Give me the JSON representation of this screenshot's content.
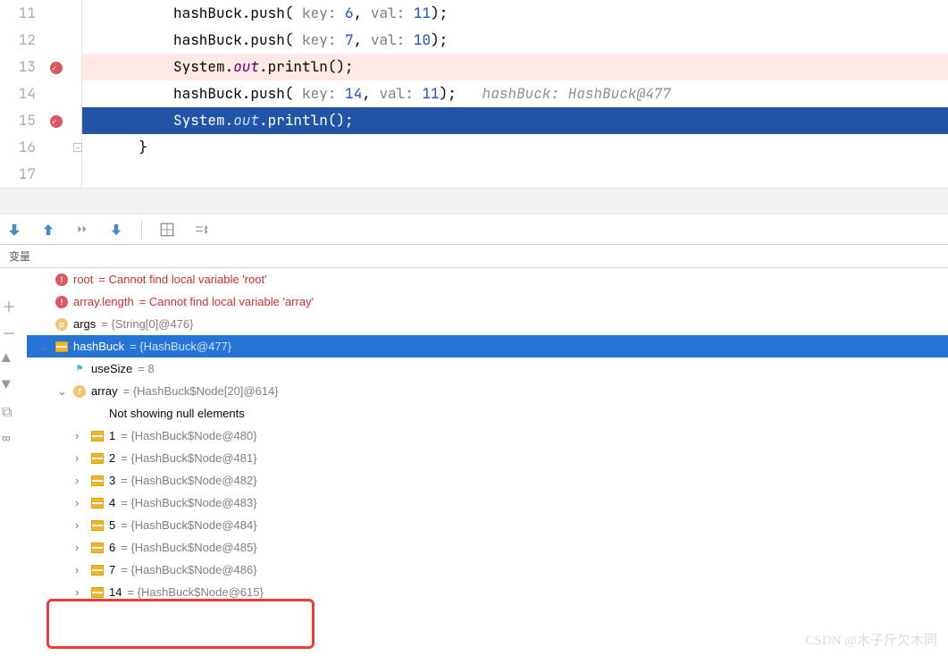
{
  "editor": {
    "lines": [
      {
        "num": "11",
        "bp": false,
        "exec": false,
        "cls": "",
        "html": "hashBuck.push( <gray>key:</gray> <num>6</num>, <gray>val:</gray> <num>11</num>);"
      },
      {
        "num": "12",
        "bp": false,
        "exec": false,
        "cls": "",
        "html": "hashBuck.push( <gray>key:</gray> <num>7</num>, <gray>val:</gray> <num>10</num>);"
      },
      {
        "num": "13",
        "bp": true,
        "exec": false,
        "cls": "row-bp",
        "html": "System.<ital>out</ital>.println();"
      },
      {
        "num": "14",
        "bp": false,
        "exec": false,
        "cls": "",
        "html": "hashBuck.push( <gray>key:</gray> <num>14</num>, <gray>val:</gray> <num>11</num>);   <igray>hashBuck: HashBuck@477</igray>"
      },
      {
        "num": "15",
        "bp": true,
        "exec": true,
        "cls": "row-exec",
        "html": "System.<ital>out</ital>.println();"
      },
      {
        "num": "16",
        "bp": false,
        "exec": false,
        "cls": "",
        "html": "}"
      }
    ],
    "blank": "17"
  },
  "panel": {
    "header": "变量",
    "rows": [
      {
        "d": 0,
        "chev": "",
        "icon": "oct",
        "name": "root",
        "eq": " = ",
        "val": "Cannot find local variable 'root'",
        "err": true
      },
      {
        "d": 0,
        "chev": "",
        "icon": "oct",
        "name": "array.length",
        "eq": " = ",
        "val": "Cannot find local variable 'array'",
        "err": true
      },
      {
        "d": 0,
        "chev": "",
        "icon": "p",
        "name": "args",
        "eq": " = ",
        "val": "{String[0]@476}"
      },
      {
        "d": 0,
        "chev": "v",
        "icon": "node",
        "name": "hashBuck",
        "eq": " = ",
        "val": "{HashBuck@477}",
        "selected": true
      },
      {
        "d": 1,
        "chev": "",
        "icon": "flag",
        "name": "useSize",
        "eq": " = ",
        "val": "8"
      },
      {
        "d": 1,
        "chev": "v",
        "icon": "f",
        "name": "array",
        "eq": " = ",
        "val": "{HashBuck$Node[20]@614}"
      },
      {
        "d": 2,
        "chev": "",
        "icon": "",
        "name": "Not showing null elements",
        "eq": "",
        "val": ""
      },
      {
        "d": 2,
        "chev": ">",
        "icon": "node",
        "name": "1",
        "eq": " = ",
        "val": "{HashBuck$Node@480}"
      },
      {
        "d": 2,
        "chev": ">",
        "icon": "node",
        "name": "2",
        "eq": " = ",
        "val": "{HashBuck$Node@481}"
      },
      {
        "d": 2,
        "chev": ">",
        "icon": "node",
        "name": "3",
        "eq": " = ",
        "val": "{HashBuck$Node@482}"
      },
      {
        "d": 2,
        "chev": ">",
        "icon": "node",
        "name": "4",
        "eq": " = ",
        "val": "{HashBuck$Node@483}"
      },
      {
        "d": 2,
        "chev": ">",
        "icon": "node",
        "name": "5",
        "eq": " = ",
        "val": "{HashBuck$Node@484}"
      },
      {
        "d": 2,
        "chev": ">",
        "icon": "node",
        "name": "6",
        "eq": " = ",
        "val": "{HashBuck$Node@485}"
      },
      {
        "d": 2,
        "chev": ">",
        "icon": "node",
        "name": "7",
        "eq": " = ",
        "val": "{HashBuck$Node@486}"
      },
      {
        "d": 2,
        "chev": ">",
        "icon": "node",
        "name": "14",
        "eq": " = ",
        "val": "{HashBuck$Node@615}"
      }
    ]
  },
  "watermark": "CSDN @木子斤欠木同"
}
